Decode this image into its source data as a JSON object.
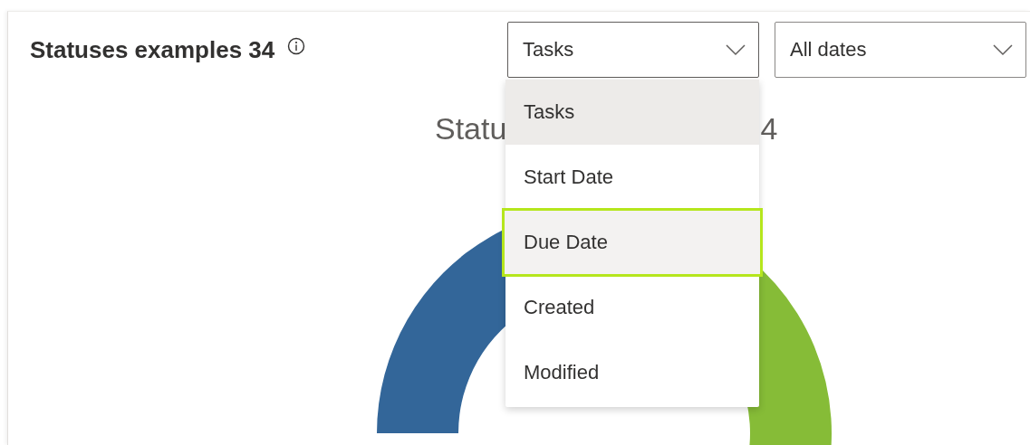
{
  "card": {
    "title": "Statuses examples 34"
  },
  "filters": [
    {
      "value": "Tasks",
      "open": true
    },
    {
      "value": "All dates",
      "open": false
    }
  ],
  "menu": {
    "items": [
      {
        "label": "Tasks",
        "selected": true,
        "focused": false
      },
      {
        "label": "Start Date",
        "selected": false,
        "focused": false
      },
      {
        "label": "Due Date",
        "selected": false,
        "focused": true
      },
      {
        "label": "Created",
        "selected": false,
        "focused": false
      },
      {
        "label": "Modified",
        "selected": false,
        "focused": false
      }
    ]
  },
  "chart": {
    "title_parts": [
      "Statu",
      "4"
    ]
  }
}
